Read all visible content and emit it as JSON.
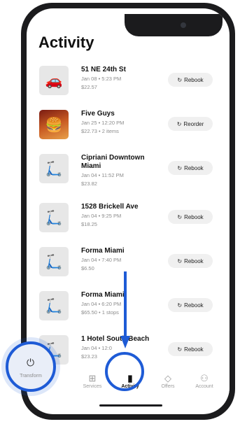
{
  "header": {
    "title": "Activity"
  },
  "items": [
    {
      "name": "51 NE 24th St",
      "date": "Jan 08 • 5:23 PM",
      "price": "$22.57",
      "action": "Rebook",
      "thumb_icon": "car-icon"
    },
    {
      "name": "Five Guys",
      "date": "Jan 25 • 12:20 PM",
      "price": "$22.73 • 2 items",
      "action": "Reorder",
      "thumb_icon": "food-photo"
    },
    {
      "name": "Cipriani Downtown Miami",
      "date": "Jan 04 • 11:52 PM",
      "price": "$23.82",
      "action": "Rebook",
      "thumb_icon": "scooter-icon"
    },
    {
      "name": "1528 Brickell Ave",
      "date": "Jan 04 • 9:25 PM",
      "price": "$18.25",
      "action": "Rebook",
      "thumb_icon": "scooter-icon"
    },
    {
      "name": "Forma Miami",
      "date": "Jan 04 • 7:40 PM",
      "price": "$6.50",
      "action": "Rebook",
      "thumb_icon": "scooter-icon"
    },
    {
      "name": "Forma Miami",
      "date": "Jan 04 • 6:20 PM",
      "price": "$65.50 • 1 stops",
      "action": "Rebook",
      "thumb_icon": "scooter-icon"
    },
    {
      "name": "1 Hotel South Beach",
      "date": "Jan 04 • 12:0",
      "price": "$23.23",
      "action": "Rebook",
      "thumb_icon": "scooter-icon"
    }
  ],
  "tabbar": {
    "tabs": [
      {
        "label": "Transform",
        "icon": "power-icon"
      },
      {
        "label": "Services",
        "icon": "grid-icon"
      },
      {
        "label": "Activity",
        "icon": "receipt-icon",
        "active": true
      },
      {
        "label": "Offers",
        "icon": "tag-icon"
      },
      {
        "label": "Account",
        "icon": "person-icon"
      }
    ]
  },
  "colors": {
    "highlight": "#1e5bd6",
    "accent_text": "#111111",
    "muted_text": "#8c8c8c"
  }
}
